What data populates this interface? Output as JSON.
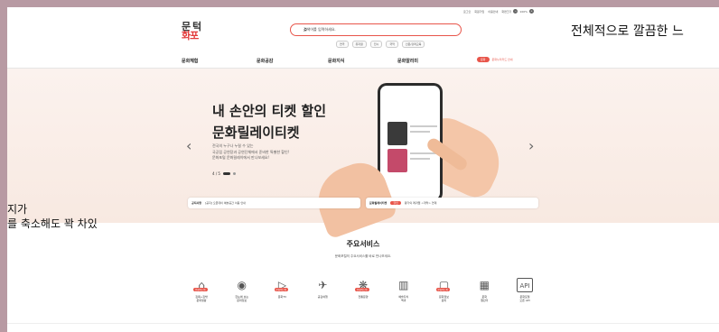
{
  "top_links": [
    "로그인",
    "회원가입",
    "이용안내",
    "화면크기"
  ],
  "zoom": "100%",
  "logo": {
    "line1": "문 턱",
    "line2": "화포"
  },
  "search": {
    "placeholder": "검색어를 입력하세요."
  },
  "chips": [
    "연극",
    "뮤지컬",
    "전시",
    "국악",
    "인문/강좌교육"
  ],
  "overlay": {
    "line1": "전체적으로 깔끔한 느",
    "line2a": "지가",
    "line2b": "를 축소해도 꽉 차있"
  },
  "nav": [
    "문화체험",
    "문화공감",
    "문화지식",
    "문화알리미"
  ],
  "nav_extra": {
    "pill": "문화",
    "label": "문화누리카드 안내"
  },
  "hero": {
    "title1": "내 손안의 티켓 할인",
    "title2": "문화릴레이티켓",
    "sub1": "전국의 누구나 누릴 수 있는",
    "sub2": "국공립 공연장과 공연단체에서 준비한 특별한 할인!",
    "sub3": "문화포털 문화릴레이에서 만나보세요!",
    "page": "4 / 5"
  },
  "info_bar": [
    {
      "title": "공지사항",
      "text": "[공지] 오픈데이 예술공간 이용 안내"
    },
    {
      "title": "문화릴레이티켓",
      "pill": "할인",
      "text": "왕가의 레퀴엠 <개막> 연계"
    }
  ],
  "services_title": "주요서비스",
  "services_sub": "문화포털의 주요서비스를 바로 만나보세요.",
  "services": [
    {
      "label1": "집콕+집밖",
      "label2": "문화생활",
      "icon": "⌂",
      "badge": "문화어드바"
    },
    {
      "label1": "한눈에 보는",
      "label2": "문화정보",
      "icon": "◉",
      "badge": ""
    },
    {
      "label1": "문화TV",
      "label2": "",
      "icon": "▷",
      "badge": "문화어드바"
    },
    {
      "label1": "공감여행",
      "label2": "",
      "icon": "✈",
      "badge": ""
    },
    {
      "label1": "전통문양",
      "label2": "",
      "icon": "❋",
      "badge": "문화어드바"
    },
    {
      "label1": "예술지식",
      "label2": "백과",
      "icon": "▥",
      "badge": ""
    },
    {
      "label1": "문화정보",
      "label2": "원지",
      "icon": "▢",
      "badge": "문화어드바"
    },
    {
      "label1": "문화",
      "label2": "캘린더",
      "icon": "▦",
      "badge": ""
    },
    {
      "label1": "문화포털",
      "label2": "오픈 API",
      "icon": "API",
      "badge": ""
    }
  ]
}
